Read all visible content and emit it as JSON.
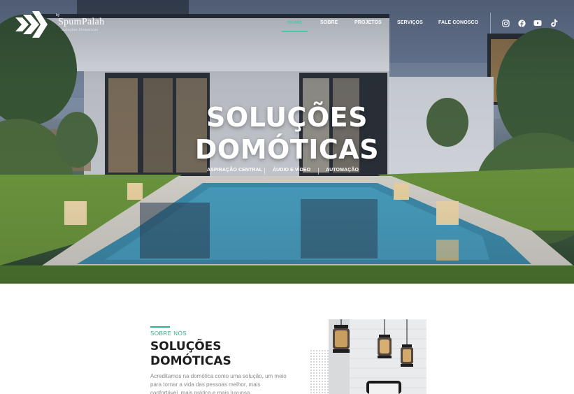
{
  "brand": {
    "by": "by",
    "name": "SpumPalah",
    "tagline": "Soluções Domóticas"
  },
  "nav": {
    "items": [
      {
        "label": "HOME",
        "active": true
      },
      {
        "label": "SOBRE",
        "active": false
      },
      {
        "label": "PROJETOS",
        "active": false
      },
      {
        "label": "SERVIÇOS",
        "active": false
      },
      {
        "label": "FALE CONOSCO",
        "active": false
      }
    ],
    "accent": "#3fd0a8"
  },
  "social": [
    "instagram-icon",
    "facebook-icon",
    "youtube-icon",
    "tiktok-icon"
  ],
  "hero": {
    "title_line1": "SOLUÇÕES",
    "title_line2": "DOMÓTICAS",
    "links": [
      "ASPIRAÇÃO CENTRAL",
      "ÁUDIO E VÍDEO",
      "AUTOMAÇÃO"
    ]
  },
  "about": {
    "kicker": "SOBRE NÓS",
    "title_line1": "SOLUÇÕES",
    "title_line2": "DOMÓTICAS",
    "text": "Acreditamos na domótica como uma solução, um meio para tornar a vida das pessoas melhor, mais confortável, mais prática e mais luxuosa.",
    "accent": "#2bb38a"
  }
}
